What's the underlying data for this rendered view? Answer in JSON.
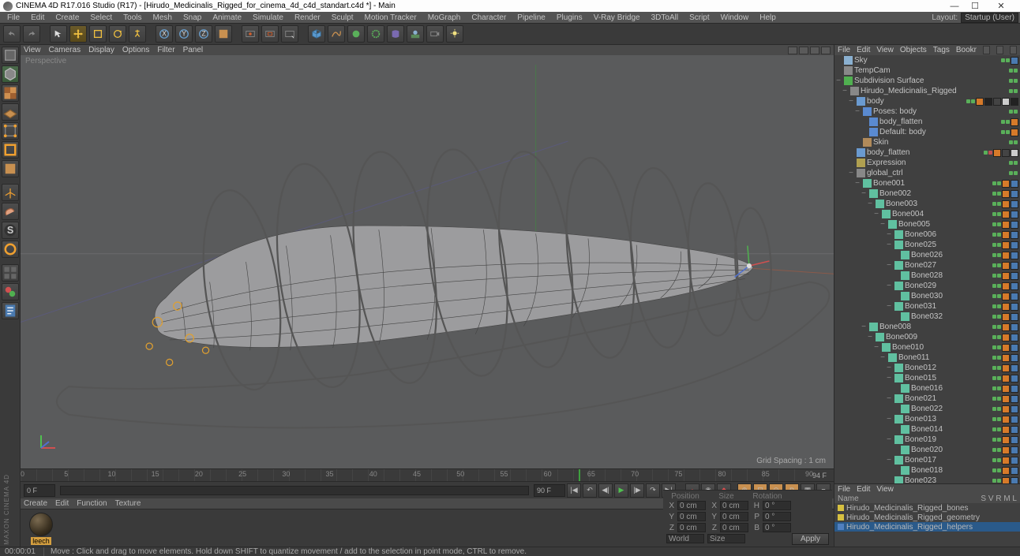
{
  "titlebar": {
    "app": "CINEMA 4D R17.016 Studio (R17)",
    "file": "[Hirudo_Medicinalis_Rigged_for_cinema_4d_c4d_standart.c4d *]",
    "suffix": "Main"
  },
  "menubar": [
    "File",
    "Edit",
    "Create",
    "Select",
    "Tools",
    "Mesh",
    "Snap",
    "Animate",
    "Simulate",
    "Render",
    "Sculpt",
    "Motion Tracker",
    "MoGraph",
    "Character",
    "Pipeline",
    "Plugins",
    "V-Ray Bridge",
    "3DToAll",
    "Script",
    "Window",
    "Help"
  ],
  "layout_label": "Layout:",
  "layout_value": "Startup (User)",
  "viewport_menu": [
    "View",
    "Cameras",
    "Display",
    "Options",
    "Filter",
    "Panel"
  ],
  "viewport": {
    "label": "Perspective",
    "grid": "Grid Spacing : 1 cm"
  },
  "timeline": {
    "start": 0,
    "end": 90,
    "cur": 64,
    "ticks": [
      0,
      5,
      10,
      15,
      20,
      25,
      30,
      35,
      40,
      45,
      50,
      55,
      60,
      65,
      70,
      75,
      80,
      85,
      90
    ],
    "end_label": "94 F"
  },
  "transport": {
    "left_field": "0 F",
    "right_field": "90 F"
  },
  "mat_menu": [
    "Create",
    "Edit",
    "Function",
    "Texture"
  ],
  "material": {
    "name": "leech"
  },
  "obj_menu": [
    "File",
    "Edit",
    "View",
    "Objects",
    "Tags",
    "Bookmarks"
  ],
  "obj_menu_short": "Bookr",
  "objects": [
    {
      "d": 0,
      "exp": "",
      "ic": "sky",
      "name": "Sky",
      "dots": [
        "g",
        "g"
      ],
      "tags": [
        "blu"
      ]
    },
    {
      "d": 0,
      "exp": "",
      "ic": "cam",
      "name": "TempCam",
      "dots": [
        "g",
        "g"
      ],
      "tags": []
    },
    {
      "d": 0,
      "exp": "−",
      "ic": "sds",
      "name": "Subdivision Surface",
      "dots": [
        "g",
        "g"
      ],
      "tags": []
    },
    {
      "d": 1,
      "exp": "−",
      "ic": "null",
      "name": "Hirudo_Medicinalis_Rigged",
      "dots": [
        "g",
        "g"
      ],
      "tags": []
    },
    {
      "d": 2,
      "exp": "−",
      "ic": "poly",
      "name": "body",
      "dots": [
        "g",
        "g"
      ],
      "tags": [
        "ora",
        "blk",
        "dk",
        "wht",
        "blk"
      ]
    },
    {
      "d": 3,
      "exp": "−",
      "ic": "pose",
      "name": "Poses: body",
      "dots": [
        "g",
        "g"
      ],
      "tags": []
    },
    {
      "d": 4,
      "exp": "",
      "ic": "pose",
      "name": "body_flatten",
      "dots": [
        "g",
        "g"
      ],
      "tags": [
        "ora"
      ]
    },
    {
      "d": 4,
      "exp": "",
      "ic": "pose",
      "name": "Default: body",
      "dots": [
        "g",
        "g"
      ],
      "tags": [
        "ora"
      ]
    },
    {
      "d": 3,
      "exp": "",
      "ic": "skin",
      "name": "Skin",
      "dots": [
        "g",
        "g"
      ],
      "tags": []
    },
    {
      "d": 2,
      "exp": "",
      "ic": "poly",
      "name": "body_flatten",
      "dots": [
        "g",
        "r"
      ],
      "tags": [
        "ora",
        "dk",
        "wht"
      ]
    },
    {
      "d": 2,
      "exp": "",
      "ic": "xp",
      "name": "Expression",
      "dots": [
        "g",
        "g"
      ],
      "tags": []
    },
    {
      "d": 2,
      "exp": "−",
      "ic": "null",
      "name": "global_ctrl",
      "dots": [
        "g",
        "g"
      ],
      "tags": []
    },
    {
      "d": 3,
      "exp": "−",
      "ic": "bone",
      "name": "Bone001",
      "dots": [
        "g",
        "g"
      ],
      "tags": [
        "ora",
        "blu"
      ]
    },
    {
      "d": 4,
      "exp": "−",
      "ic": "bone",
      "name": "Bone002",
      "dots": [
        "g",
        "g"
      ],
      "tags": [
        "ora",
        "blu"
      ]
    },
    {
      "d": 5,
      "exp": "−",
      "ic": "bone",
      "name": "Bone003",
      "dots": [
        "g",
        "g"
      ],
      "tags": [
        "ora",
        "blu"
      ]
    },
    {
      "d": 6,
      "exp": "−",
      "ic": "bone",
      "name": "Bone004",
      "dots": [
        "g",
        "g"
      ],
      "tags": [
        "ora",
        "blu"
      ]
    },
    {
      "d": 7,
      "exp": "−",
      "ic": "bone",
      "name": "Bone005",
      "dots": [
        "g",
        "g"
      ],
      "tags": [
        "ora",
        "blu"
      ]
    },
    {
      "d": 8,
      "exp": "−",
      "ic": "bone",
      "name": "Bone006",
      "dots": [
        "g",
        "g"
      ],
      "tags": [
        "ora",
        "blu"
      ]
    },
    {
      "d": 8,
      "exp": "−",
      "ic": "bone",
      "name": "Bone025",
      "dots": [
        "g",
        "g"
      ],
      "tags": [
        "ora",
        "blu"
      ]
    },
    {
      "d": 9,
      "exp": "",
      "ic": "bone",
      "name": "Bone026",
      "dots": [
        "g",
        "g"
      ],
      "tags": [
        "ora",
        "blu"
      ]
    },
    {
      "d": 8,
      "exp": "−",
      "ic": "bone",
      "name": "Bone027",
      "dots": [
        "g",
        "g"
      ],
      "tags": [
        "ora",
        "blu"
      ]
    },
    {
      "d": 9,
      "exp": "",
      "ic": "bone",
      "name": "Bone028",
      "dots": [
        "g",
        "g"
      ],
      "tags": [
        "ora",
        "blu"
      ]
    },
    {
      "d": 8,
      "exp": "−",
      "ic": "bone",
      "name": "Bone029",
      "dots": [
        "g",
        "g"
      ],
      "tags": [
        "ora",
        "blu"
      ]
    },
    {
      "d": 9,
      "exp": "",
      "ic": "bone",
      "name": "Bone030",
      "dots": [
        "g",
        "g"
      ],
      "tags": [
        "ora",
        "blu"
      ]
    },
    {
      "d": 8,
      "exp": "−",
      "ic": "bone",
      "name": "Bone031",
      "dots": [
        "g",
        "g"
      ],
      "tags": [
        "ora",
        "blu"
      ]
    },
    {
      "d": 9,
      "exp": "",
      "ic": "bone",
      "name": "Bone032",
      "dots": [
        "g",
        "g"
      ],
      "tags": [
        "ora",
        "blu"
      ]
    },
    {
      "d": 4,
      "exp": "−",
      "ic": "bone",
      "name": "Bone008",
      "dots": [
        "g",
        "g"
      ],
      "tags": [
        "ora",
        "blu"
      ]
    },
    {
      "d": 5,
      "exp": "−",
      "ic": "bone",
      "name": "Bone009",
      "dots": [
        "g",
        "g"
      ],
      "tags": [
        "ora",
        "blu"
      ]
    },
    {
      "d": 6,
      "exp": "−",
      "ic": "bone",
      "name": "Bone010",
      "dots": [
        "g",
        "g"
      ],
      "tags": [
        "ora",
        "blu"
      ]
    },
    {
      "d": 7,
      "exp": "−",
      "ic": "bone",
      "name": "Bone011",
      "dots": [
        "g",
        "g"
      ],
      "tags": [
        "ora",
        "blu"
      ]
    },
    {
      "d": 8,
      "exp": "−",
      "ic": "bone",
      "name": "Bone012",
      "dots": [
        "g",
        "g"
      ],
      "tags": [
        "ora",
        "blu"
      ]
    },
    {
      "d": 8,
      "exp": "−",
      "ic": "bone",
      "name": "Bone015",
      "dots": [
        "g",
        "g"
      ],
      "tags": [
        "ora",
        "blu"
      ]
    },
    {
      "d": 9,
      "exp": "",
      "ic": "bone",
      "name": "Bone016",
      "dots": [
        "g",
        "g"
      ],
      "tags": [
        "ora",
        "blu"
      ]
    },
    {
      "d": 8,
      "exp": "−",
      "ic": "bone",
      "name": "Bone021",
      "dots": [
        "g",
        "g"
      ],
      "tags": [
        "ora",
        "blu"
      ]
    },
    {
      "d": 9,
      "exp": "",
      "ic": "bone",
      "name": "Bone022",
      "dots": [
        "g",
        "g"
      ],
      "tags": [
        "ora",
        "blu"
      ]
    },
    {
      "d": 8,
      "exp": "−",
      "ic": "bone",
      "name": "Bone013",
      "dots": [
        "g",
        "g"
      ],
      "tags": [
        "ora",
        "blu"
      ]
    },
    {
      "d": 9,
      "exp": "",
      "ic": "bone",
      "name": "Bone014",
      "dots": [
        "g",
        "g"
      ],
      "tags": [
        "ora",
        "blu"
      ]
    },
    {
      "d": 8,
      "exp": "−",
      "ic": "bone",
      "name": "Bone019",
      "dots": [
        "g",
        "g"
      ],
      "tags": [
        "ora",
        "blu"
      ]
    },
    {
      "d": 9,
      "exp": "",
      "ic": "bone",
      "name": "Bone020",
      "dots": [
        "g",
        "g"
      ],
      "tags": [
        "ora",
        "blu"
      ]
    },
    {
      "d": 8,
      "exp": "−",
      "ic": "bone",
      "name": "Bone017",
      "dots": [
        "g",
        "g"
      ],
      "tags": [
        "ora",
        "blu"
      ]
    },
    {
      "d": 9,
      "exp": "",
      "ic": "bone",
      "name": "Bone018",
      "dots": [
        "g",
        "g"
      ],
      "tags": [
        "ora",
        "blu"
      ]
    },
    {
      "d": 8,
      "exp": "",
      "ic": "bone",
      "name": "Bone023",
      "dots": [
        "g",
        "g"
      ],
      "tags": [
        "ora",
        "blu"
      ]
    }
  ],
  "coords": {
    "rows": [
      {
        "l1": "X",
        "v1": "0 cm",
        "l2": "X",
        "v2": "0 cm",
        "l3": "H",
        "v3": "0 °"
      },
      {
        "l1": "Y",
        "v1": "0 cm",
        "l2": "Y",
        "v2": "0 cm",
        "l3": "P",
        "v3": "0 °"
      },
      {
        "l1": "Z",
        "v1": "0 cm",
        "l2": "Z",
        "v2": "0 cm",
        "l3": "B",
        "v3": "0 °"
      }
    ],
    "world": "World",
    "size": "Size",
    "apply": "Apply"
  },
  "lower_menu": [
    "File",
    "Edit",
    "View"
  ],
  "lower_head": {
    "name": "Name",
    "cols": "S   V   R   M   L"
  },
  "layers": [
    {
      "c": "y",
      "name": "Hirudo_Medicinalis_Rigged_bones",
      "sel": false
    },
    {
      "c": "y",
      "name": "Hirudo_Medicinalis_Rigged_geometry",
      "sel": false
    },
    {
      "c": "b",
      "name": "Hirudo_Medicinalis_Rigged_helpers",
      "sel": true
    }
  ],
  "status": {
    "time": "00:00:01",
    "hint": "Move : Click and drag to move elements. Hold down SHIFT to quantize movement / add to the selection in point mode, CTRL to remove."
  }
}
